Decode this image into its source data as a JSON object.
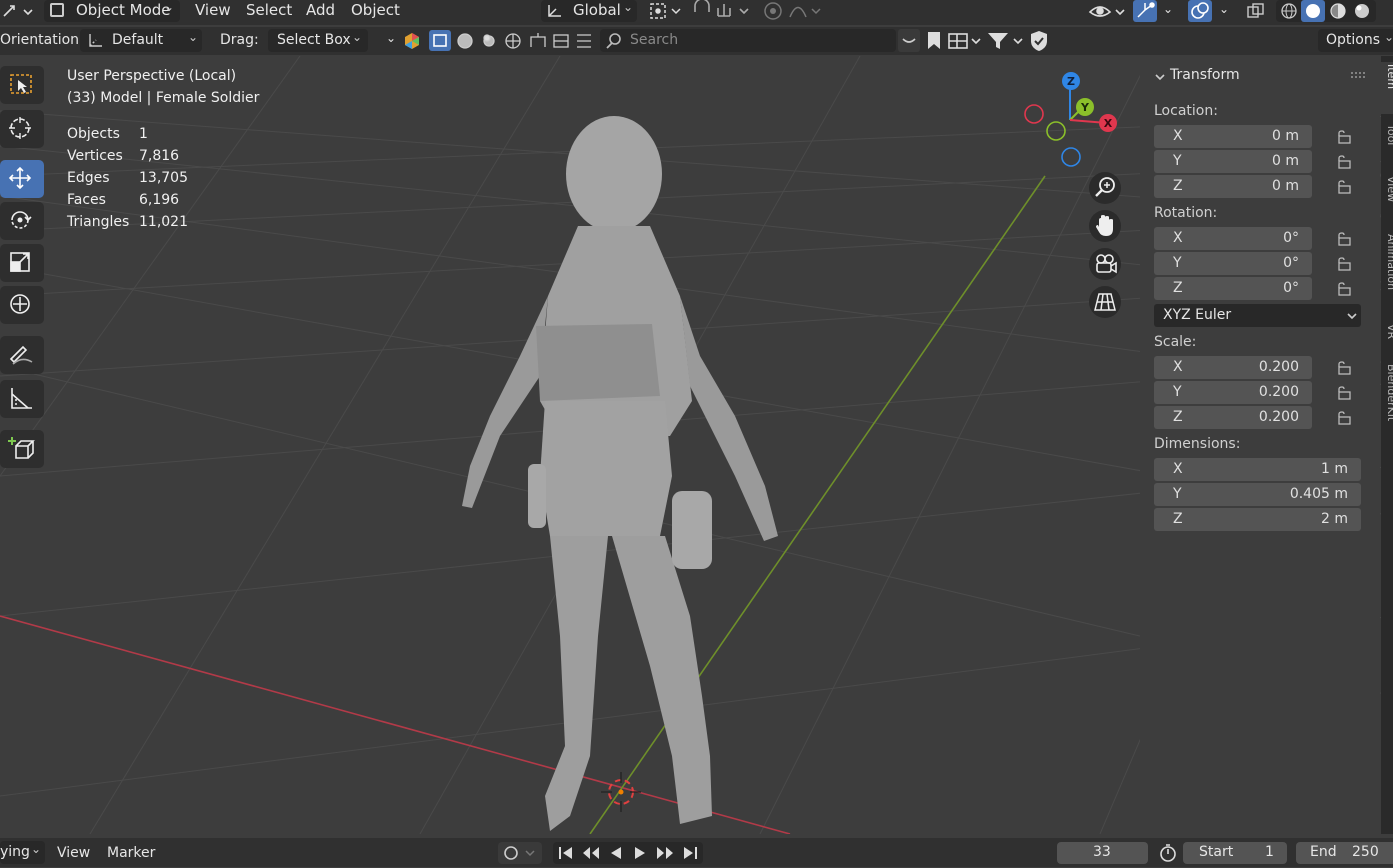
{
  "header": {
    "mode": "Object Mode",
    "menu": [
      "View",
      "Select",
      "Add",
      "Object"
    ],
    "transform_orientation": "Global"
  },
  "tool_settings": {
    "orientation_label": "Orientation:",
    "orientation_value": "Default",
    "drag_label": "Drag:",
    "drag_value": "Select Box",
    "search_placeholder": "Search",
    "options_label": "Options"
  },
  "viewport": {
    "view_name": "User Perspective (Local)",
    "object_info": "(33) Model | Female Soldier",
    "stats": [
      {
        "label": "Objects",
        "value": "1"
      },
      {
        "label": "Vertices",
        "value": "7,816"
      },
      {
        "label": "Edges",
        "value": "13,705"
      },
      {
        "label": "Faces",
        "value": "6,196"
      },
      {
        "label": "Triangles",
        "value": "11,021"
      }
    ],
    "gizmo_axes": [
      "Z",
      "Y",
      "X"
    ]
  },
  "sidebar": {
    "panel_title": "Transform",
    "location_label": "Location:",
    "location": [
      {
        "axis": "X",
        "value": "0 m"
      },
      {
        "axis": "Y",
        "value": "0 m"
      },
      {
        "axis": "Z",
        "value": "0 m"
      }
    ],
    "rotation_label": "Rotation:",
    "rotation": [
      {
        "axis": "X",
        "value": "0°"
      },
      {
        "axis": "Y",
        "value": "0°"
      },
      {
        "axis": "Z",
        "value": "0°"
      }
    ],
    "rotation_mode": "XYZ Euler",
    "scale_label": "Scale:",
    "scale": [
      {
        "axis": "X",
        "value": "0.200"
      },
      {
        "axis": "Y",
        "value": "0.200"
      },
      {
        "axis": "Z",
        "value": "0.200"
      }
    ],
    "dimensions_label": "Dimensions:",
    "dimensions": [
      {
        "axis": "X",
        "value": "1 m"
      },
      {
        "axis": "Y",
        "value": "0.405 m"
      },
      {
        "axis": "Z",
        "value": "2 m"
      }
    ],
    "tabs": [
      "Item",
      "Tool",
      "View",
      "Animation",
      "VR",
      "BlenderKit"
    ]
  },
  "timeline": {
    "playback_partial": "ying",
    "view_label": "View",
    "marker_label": "Marker",
    "current_frame": "33",
    "start_label": "Start",
    "start_value": "1",
    "end_label": "End",
    "end_value": "250"
  },
  "colors": {
    "active_tool": "#4772b3",
    "x_axis": "#e0374e",
    "y_axis": "#8bbf2a",
    "z_axis": "#2f86e6"
  }
}
